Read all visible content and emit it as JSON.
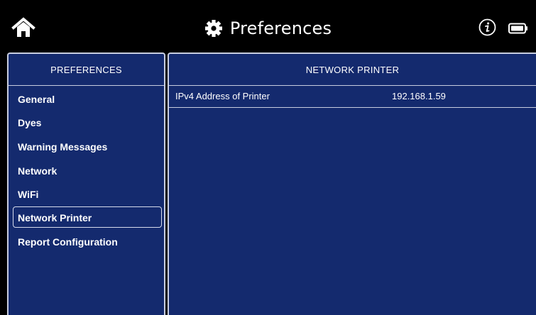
{
  "header": {
    "title": "Preferences",
    "title_icon": "gear-icon",
    "home_icon": "home-icon",
    "info_icon": "info-icon",
    "battery_icon": "battery-icon"
  },
  "sidebar": {
    "heading": "PREFERENCES",
    "items": [
      {
        "label": "General"
      },
      {
        "label": "Dyes"
      },
      {
        "label": "Warning Messages"
      },
      {
        "label": "Network"
      },
      {
        "label": "WiFi"
      },
      {
        "label": "Network Printer"
      },
      {
        "label": "Report Configuration"
      }
    ],
    "selected": "Network Printer"
  },
  "main": {
    "heading": "NETWORK PRINTER",
    "settings": [
      {
        "label": "IPv4 Address of Printer",
        "value": "192.168.1.59"
      }
    ]
  },
  "colors": {
    "background": "#000000",
    "panel": "#142a6e",
    "border": "#c8cde0",
    "text": "#ffffff"
  }
}
